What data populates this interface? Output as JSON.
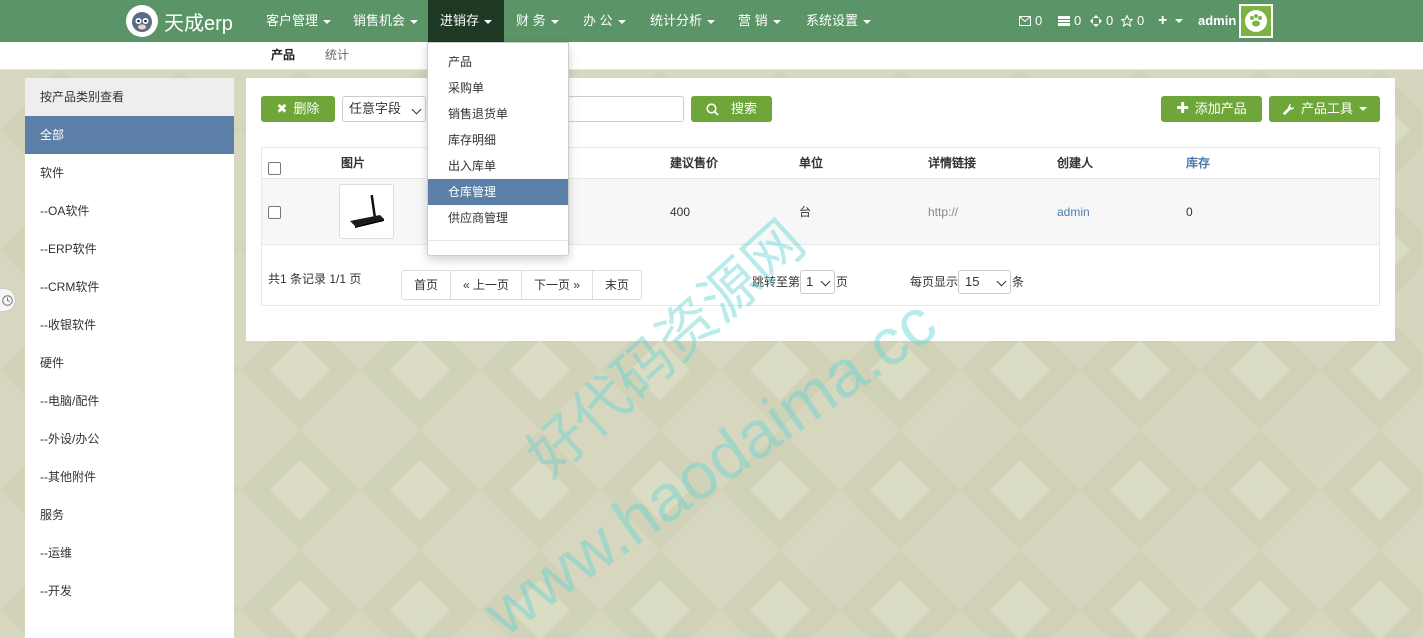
{
  "app": {
    "logo_text": "天成erp",
    "user": "admin"
  },
  "nav": {
    "items": [
      "客户管理",
      "销售机会",
      "进销存",
      "财 务",
      "办 公",
      "统计分析",
      "营 销",
      "系统设置"
    ],
    "active_index": 2,
    "counters": {
      "mail": "0",
      "tasks": "0",
      "move": "0",
      "star": "0"
    }
  },
  "subnav": {
    "tabs": [
      "产品",
      "统计"
    ],
    "active_index": 0
  },
  "dropdown": {
    "items": [
      "产品",
      "采购单",
      "销售退货单",
      "库存明细",
      "出入库单",
      "仓库管理",
      "供应商管理"
    ],
    "active_index": 5
  },
  "sidebar": {
    "title": "按产品类别查看",
    "items": [
      "全部",
      "软件",
      "--OA软件",
      "--ERP软件",
      "--CRM软件",
      "--收银软件",
      "硬件",
      "--电脑/配件",
      "--外设/办公",
      "--其他附件",
      "服务",
      "--运维",
      "--开发"
    ],
    "active_index": 0
  },
  "toolbar": {
    "delete_label": "删除",
    "field_select": "任意字段",
    "search_placeholder": "",
    "search_label": "搜索",
    "add_label": "添加产品",
    "tools_label": "产品工具"
  },
  "table": {
    "headers": {
      "image": "图片",
      "price": "建议售价",
      "unit": "单位",
      "link": "详情链接",
      "creator": "创建人",
      "stock": "库存"
    },
    "rows": [
      {
        "price": "400",
        "unit": "台",
        "link": "http://",
        "creator": "admin",
        "stock": "0"
      }
    ]
  },
  "pagination": {
    "summary": "共1 条记录 1/1 页",
    "first": "首页",
    "prev": "« 上一页",
    "next": "下一页 »",
    "last": "末页",
    "jump_prefix": "跳转至第",
    "jump_value": "1",
    "jump_suffix": "页",
    "per_prefix": "每页显示",
    "per_value": "15",
    "per_suffix": "条"
  },
  "watermark": {
    "cn": "好代码资源网",
    "url": "www.haodaima.cc"
  },
  "colors": {
    "nav": "#5b9467",
    "nav_active": "#1e3a24",
    "accent_green": "#6fa63a",
    "active_blue": "#5b7fa6",
    "link_blue": "#4b7bb0"
  }
}
